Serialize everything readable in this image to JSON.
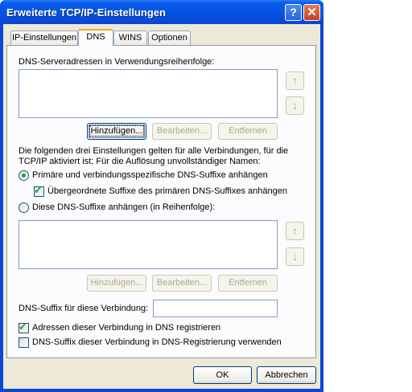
{
  "window": {
    "title": "Erweiterte TCP/IP-Einstellungen"
  },
  "titlebar": {
    "help_glyph": "?",
    "close_glyph": "✕"
  },
  "tabs": [
    "IP-Einstellungen",
    "DNS",
    "WINS",
    "Optionen"
  ],
  "dns": {
    "server_list_label": "DNS-Serveradressen in Verwendungsreihenfolge:",
    "add_label": "Hinzufügen...",
    "edit_label": "Bearbeiten...",
    "remove_label": "Entfernen",
    "info_text_line1": "Die folgenden drei Einstellungen gelten für alle Verbindungen, für die",
    "info_text_line2": "TCP/IP aktiviert ist: Für die Auflösung unvollständiger Namen:",
    "radio_primary_label": "Primäre und verbindungsspezifische DNS-Suffixe anhängen",
    "checkbox_parent_label": "Übergeordnete Suffixe des primären DNS-Suffixes anhängen",
    "radio_these_label": "Diese DNS-Suffixe anhängen (in Reihenfolge):",
    "add2_label": "Hinzufügen...",
    "edit2_label": "Bearbeiten...",
    "remove2_label": "Entfernen",
    "suffix_label": "DNS-Suffix für diese Verbindung:",
    "suffix_value": "",
    "register_label": "Adressen dieser Verbindung in DNS registrieren",
    "use_suffix_label": "DNS-Suffix dieser Verbindung in DNS-Registrierung verwenden",
    "radio_primary_checked": true,
    "radio_these_checked": false,
    "checkbox_parent_checked": true,
    "register_checked": true,
    "use_suffix_checked": false
  },
  "footer": {
    "ok_label": "OK",
    "cancel_label": "Abbrechen"
  }
}
